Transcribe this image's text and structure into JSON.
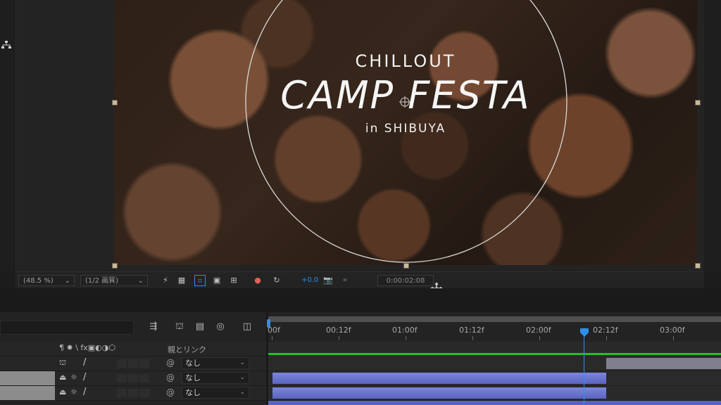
{
  "composition": {
    "title_small": "CHILLOUT",
    "title_big": "CAMP FESTA",
    "title_sub": "in SHIBUYA"
  },
  "comp_toolbar": {
    "zoom": "(48.5 %)",
    "resolution": "(1/2 画質)",
    "exposure": "+0.0",
    "timecode": "0:00:02:08"
  },
  "timeline": {
    "ruler_labels": [
      "00f",
      "00:12f",
      "01:00f",
      "01:12f",
      "02:00f",
      "02:12f",
      "03:00f"
    ],
    "column_header": {
      "switches": "¶ ✸ \\ fx▣◐◑⬡",
      "parent_label": "親とリンク"
    },
    "layers": [
      {
        "parent": "なし"
      },
      {
        "parent": "なし"
      },
      {
        "parent": "なし"
      }
    ]
  },
  "colors": {
    "accent_blue": "#2d8ceb",
    "layer_bar_purple": "#6a73c8",
    "work_area_green": "#21c11e",
    "playhead": "#2f8fe8"
  }
}
